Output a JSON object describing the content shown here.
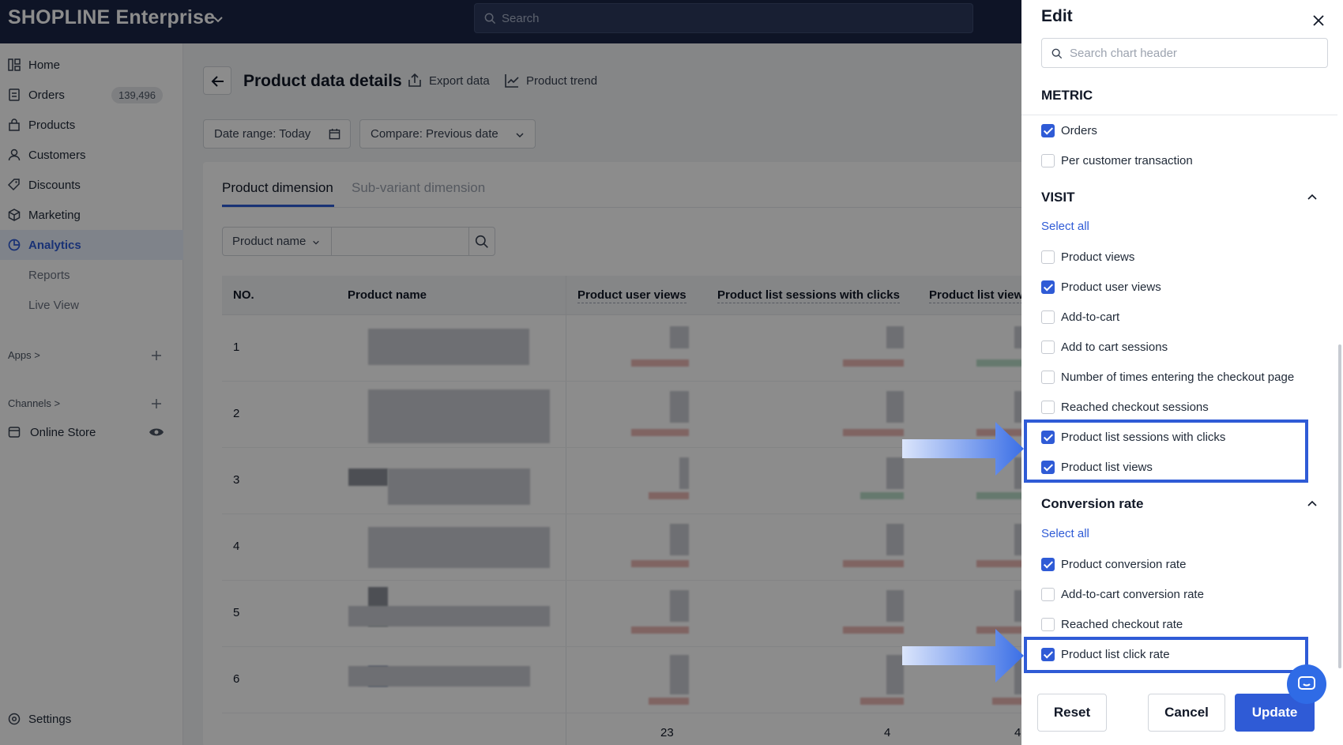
{
  "topbar": {
    "brand": "SHOPLINE Enterprise",
    "search_placeholder": "Search"
  },
  "sidebar": {
    "items": [
      {
        "label": "Home"
      },
      {
        "label": "Orders",
        "badge": "139,496"
      },
      {
        "label": "Products"
      },
      {
        "label": "Customers"
      },
      {
        "label": "Discounts"
      },
      {
        "label": "Marketing"
      },
      {
        "label": "Analytics"
      }
    ],
    "subitems": [
      "Reports",
      "Live View"
    ],
    "apps_label": "Apps >",
    "channels_label": "Channels >",
    "online_store": "Online Store",
    "settings": "Settings"
  },
  "page": {
    "title": "Product data details",
    "export": "Export data",
    "trend": "Product trend",
    "date_range": "Date range: Today",
    "compare": "Compare: Previous date",
    "tabs": [
      "Product dimension",
      "Sub-variant dimension"
    ],
    "filter_select": "Product name"
  },
  "table": {
    "headers": [
      "NO.",
      "Product name",
      "Product user views",
      "Product list sessions with clicks",
      "Product list view"
    ],
    "rows": [
      "1",
      "2",
      "3",
      "4",
      "5",
      "6"
    ],
    "partial_row": [
      "23",
      "4",
      "4"
    ]
  },
  "panel": {
    "title": "Edit",
    "search_placeholder": "Search chart header",
    "metric_title": "METRIC",
    "metric_options": [
      {
        "label": "Orders",
        "checked": true
      },
      {
        "label": "Per customer transaction",
        "checked": false
      }
    ],
    "visit_title": "VISIT",
    "select_all": "Select all",
    "visit_options": [
      {
        "label": "Product views",
        "checked": false
      },
      {
        "label": "Product user views",
        "checked": true
      },
      {
        "label": "Add-to-cart",
        "checked": false
      },
      {
        "label": "Add to cart sessions",
        "checked": false
      },
      {
        "label": "Number of times entering the checkout page",
        "checked": false
      },
      {
        "label": "Reached checkout sessions",
        "checked": false
      },
      {
        "label": "Product list sessions with clicks",
        "checked": true
      },
      {
        "label": "Product list views",
        "checked": true
      }
    ],
    "conversion_title": "Conversion rate",
    "conversion_options": [
      {
        "label": "Product conversion rate",
        "checked": true
      },
      {
        "label": "Add-to-cart conversion rate",
        "checked": false
      },
      {
        "label": "Reached checkout rate",
        "checked": false
      },
      {
        "label": "Product list click rate",
        "checked": true
      }
    ],
    "buttons": {
      "reset": "Reset",
      "cancel": "Cancel",
      "update": "Update"
    }
  },
  "colors": {
    "accent": "#2f5bd6",
    "topbar": "#1b2546",
    "highlight": "#2f5bd6"
  }
}
